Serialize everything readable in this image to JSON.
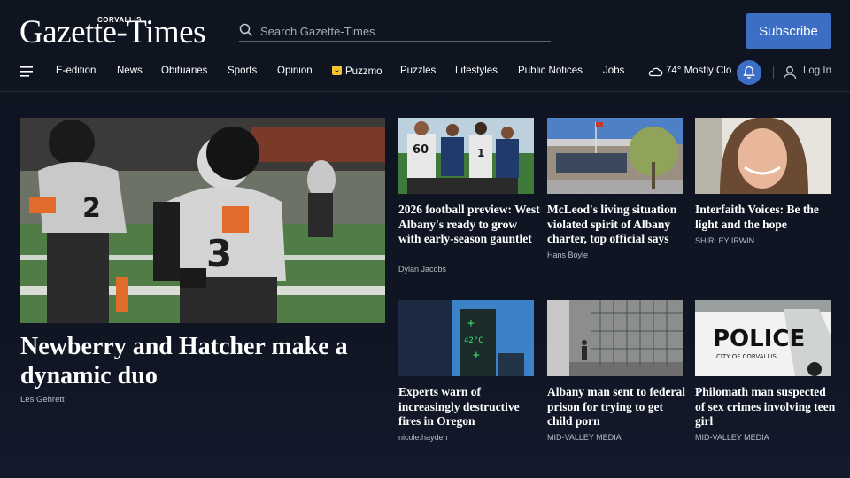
{
  "header": {
    "logo_kicker": "CORVALLIS",
    "logo_main": "Gazette-Times",
    "search_placeholder": "Search Gazette-Times",
    "subscribe_label": "Subscribe"
  },
  "nav": {
    "items": [
      "E-edition",
      "News",
      "Obituaries",
      "Sports",
      "Opinion",
      "Puzzmo",
      "Puzzles",
      "Lifestyles",
      "Public Notices",
      "Jobs"
    ],
    "weather": "74° Mostly Clo",
    "login_label": "Log In"
  },
  "colors": {
    "background": "#0e1420",
    "accent": "#3b6ec4",
    "puzzmo": "#f4c430"
  },
  "lead": {
    "title": "Newberry and Hatcher make a dynamic duo",
    "author": "Les Gehrett"
  },
  "articles": [
    {
      "title": "2026 football preview: West Albany's ready to grow with early-season gauntlet",
      "author": "Dylan Jacobs"
    },
    {
      "title": "McLeod's living situation violated spirit of Albany charter, top official says",
      "author": "Hans Boyle"
    },
    {
      "title": "Interfaith Voices: Be the light and the hope",
      "author": "SHIRLEY IRWIN"
    },
    {
      "title": "Experts warn of increasingly destructive fires in Oregon",
      "author": "nicole.hayden"
    },
    {
      "title": "Albany man sent to federal prison for trying to get child porn",
      "author": "MID-VALLEY MEDIA"
    },
    {
      "title": "Philomath man suspected of sex crimes involving teen girl",
      "author": "MID-VALLEY MEDIA"
    }
  ],
  "photo_text": {
    "jersey_60": "60",
    "jersey_1": "1",
    "police": "POLICE",
    "city_of": "CITY OF CORVALLIS",
    "temp": "42°C"
  },
  "icons": [
    "search-icon",
    "menu-icon",
    "puzzmo-icon",
    "partly-cloudy-icon",
    "bell-icon",
    "user-icon"
  ]
}
